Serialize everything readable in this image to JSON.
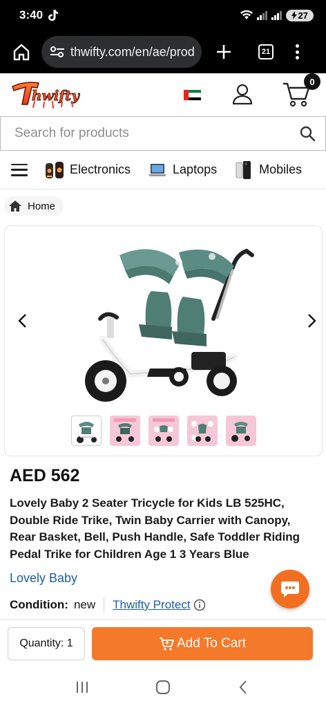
{
  "status_bar": {
    "time": "3:40",
    "battery": "27"
  },
  "browser": {
    "url": "thwifty.com/en/ae/prod",
    "tab_count": "21"
  },
  "header": {
    "logo_text": "Thwifty",
    "cart_count": "0"
  },
  "search": {
    "placeholder": "Search for products"
  },
  "categories": [
    {
      "label": "Electronics",
      "icon": "speaker-thumb"
    },
    {
      "label": "Laptops",
      "icon": "laptop-thumb"
    },
    {
      "label": "Mobiles",
      "icon": "phone-thumb"
    }
  ],
  "breadcrumb": {
    "home_label": "Home"
  },
  "product": {
    "price": "AED 562",
    "title": "Lovely Baby 2 Seater Tricycle for Kids LB 525HC, Double Ride Trike, Twin Baby Carrier with Canopy, Rear Basket, Bell, Push Handle, Safe Toddler Riding Pedal Trike for Children Age 1 3 Years Blue",
    "brand": "Lovely Baby",
    "condition_label": "Condition:",
    "condition_value": "new",
    "protect_label": "Thwifty Protect"
  },
  "buy_bar": {
    "quantity_label": "Quantity: 1",
    "add_to_cart_label": "Add To Cart"
  },
  "colors": {
    "accent": "#f4792b",
    "link": "#1d5fa4",
    "trike_green": "#5b8c84"
  }
}
